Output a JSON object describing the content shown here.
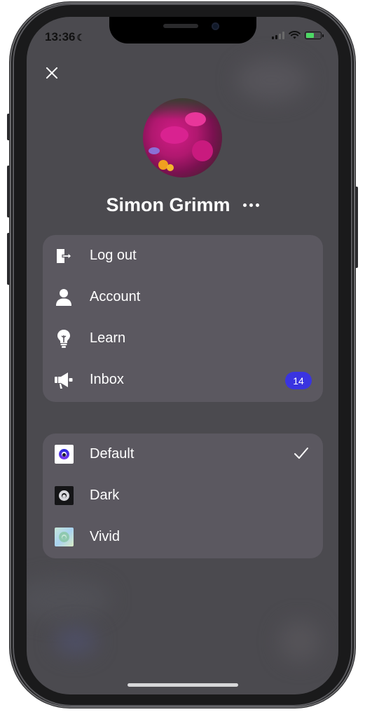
{
  "status_bar": {
    "time": "13:36",
    "moon_icon": "moon-icon"
  },
  "profile": {
    "name": "Simon Grimm",
    "avatar_icon": "avatar-flowers-photo"
  },
  "menu": {
    "items": [
      {
        "label": "Log out",
        "icon": "logout-icon"
      },
      {
        "label": "Account",
        "icon": "person-icon"
      },
      {
        "label": "Learn",
        "icon": "lightbulb-icon"
      },
      {
        "label": "Inbox",
        "icon": "megaphone-icon",
        "badge": "14"
      }
    ]
  },
  "themes": {
    "items": [
      {
        "label": "Default",
        "selected": true
      },
      {
        "label": "Dark",
        "selected": false
      },
      {
        "label": "Vivid",
        "selected": false
      }
    ]
  },
  "colors": {
    "screen_bg": "#4b4a4f",
    "card_bg": "#5b5860",
    "badge_bg": "#3a34e0",
    "text": "#ffffff"
  }
}
